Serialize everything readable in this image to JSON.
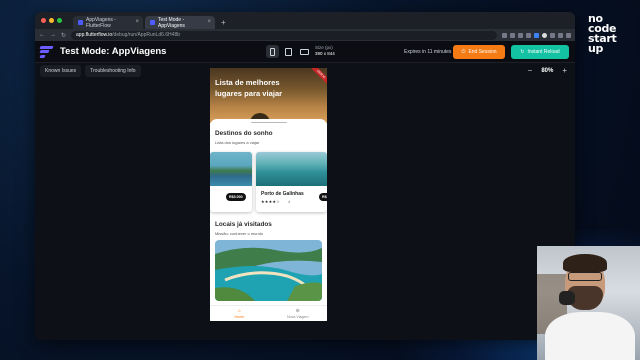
{
  "brand": {
    "lines": [
      "no",
      "code",
      "start",
      "up"
    ]
  },
  "browser": {
    "tabs": [
      {
        "label": "AppViagens - FlutterFlow"
      },
      {
        "label": "Test Mode - AppViagens"
      }
    ],
    "url_host": "app.flutterflow.io",
    "url_path": "/debug/run/AppRunLd6.6H48b"
  },
  "app_header": {
    "title": "Test Mode: AppViagens",
    "device_label": "Size (px)",
    "device_size": "390 x 844",
    "expires": "Expires in 11 minutes",
    "end_session": "End Session",
    "instant_reload": "Instant Reload"
  },
  "subbar": {
    "known_issues": "Known Issues",
    "troubleshooting": "Troubleshooting Info",
    "zoom": "80%"
  },
  "phone": {
    "hero_title": "Lista de melhores lugares para viajar",
    "debug_label": "DEBUG",
    "section1_title": "Destinos do sonho",
    "section1_sub": "Lista dos lugares a viajar",
    "cards": [
      {
        "price": "R$3.000",
        "name": ""
      },
      {
        "price": "R$3",
        "name": "Porto de Galinhas",
        "stars": "★★★★☆",
        "rating": "4"
      }
    ],
    "section2_title": "Locais já visitados",
    "section2_sub": "Missão: conhecer o mundo",
    "nav": [
      {
        "label": "Home",
        "icon": "home-icon"
      },
      {
        "label": "Nova Viagem",
        "icon": "add-circle-icon"
      }
    ]
  },
  "colors": {
    "end_session": "#f57c14",
    "instant_reload": "#13c2a3",
    "nav_active": "#f57c14",
    "flutterflow": "#6a5cff"
  }
}
